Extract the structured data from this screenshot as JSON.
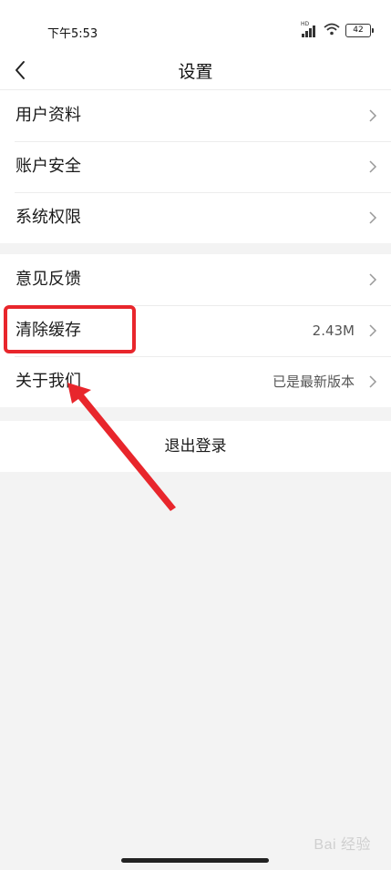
{
  "status_bar": {
    "time": "下午5:53",
    "network_label": "HD",
    "battery_level": "42",
    "icons": [
      "signal-icon",
      "wifi-icon",
      "battery-icon"
    ]
  },
  "header": {
    "title": "设置",
    "back_icon": "chevron-left-icon"
  },
  "groups": [
    {
      "items": [
        {
          "label": "用户资料",
          "value": ""
        },
        {
          "label": "账户安全",
          "value": ""
        },
        {
          "label": "系统权限",
          "value": ""
        }
      ]
    },
    {
      "items": [
        {
          "label": "意见反馈",
          "value": ""
        },
        {
          "label": "清除缓存",
          "value": "2.43M"
        },
        {
          "label": "关于我们",
          "value": "已是最新版本"
        }
      ]
    }
  ],
  "logout": {
    "label": "退出登录"
  },
  "annotation": {
    "highlight_color": "#e8262c"
  },
  "watermark": "Bai 经验",
  "colors": {
    "background": "#f3f3f3",
    "surface": "#ffffff",
    "accent": "#e8262c"
  }
}
